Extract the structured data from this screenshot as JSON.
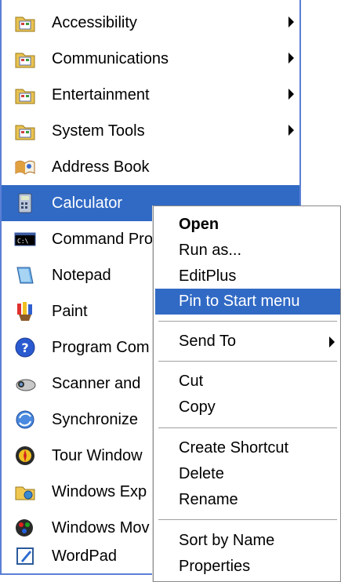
{
  "submenu": {
    "items": [
      {
        "label": "Accessibility",
        "icon": "folder-icon",
        "arrow": true
      },
      {
        "label": "Communications",
        "icon": "folder-icon",
        "arrow": true
      },
      {
        "label": "Entertainment",
        "icon": "folder-icon",
        "arrow": true
      },
      {
        "label": "System Tools",
        "icon": "folder-icon",
        "arrow": true
      },
      {
        "label": "Address Book",
        "icon": "address-book-icon"
      },
      {
        "label": "Calculator",
        "icon": "calculator-icon",
        "highlighted": true
      },
      {
        "label": "Command Pro",
        "icon": "command-prompt-icon"
      },
      {
        "label": "Notepad",
        "icon": "notepad-icon"
      },
      {
        "label": "Paint",
        "icon": "paint-icon"
      },
      {
        "label": "Program Com",
        "icon": "help-icon"
      },
      {
        "label": "Scanner and",
        "icon": "scanner-icon"
      },
      {
        "label": "Synchronize",
        "icon": "synchronize-icon"
      },
      {
        "label": "Tour Window",
        "icon": "tour-icon"
      },
      {
        "label": "Windows Exp",
        "icon": "explorer-folder-icon"
      },
      {
        "label": "Windows Mov",
        "icon": "movie-maker-icon"
      },
      {
        "label": "WordPad",
        "icon": "wordpad-icon"
      }
    ]
  },
  "context_menu": {
    "open": "Open",
    "run_as": "Run as...",
    "editplus": "EditPlus",
    "pin": "Pin to Start menu",
    "send_to": "Send To",
    "cut": "Cut",
    "copy": "Copy",
    "create_shortcut": "Create Shortcut",
    "delete": "Delete",
    "rename": "Rename",
    "sort_by_name": "Sort by Name",
    "properties": "Properties"
  },
  "colors": {
    "highlight": "#316ac5",
    "menu_border": "#5b7fd6"
  }
}
